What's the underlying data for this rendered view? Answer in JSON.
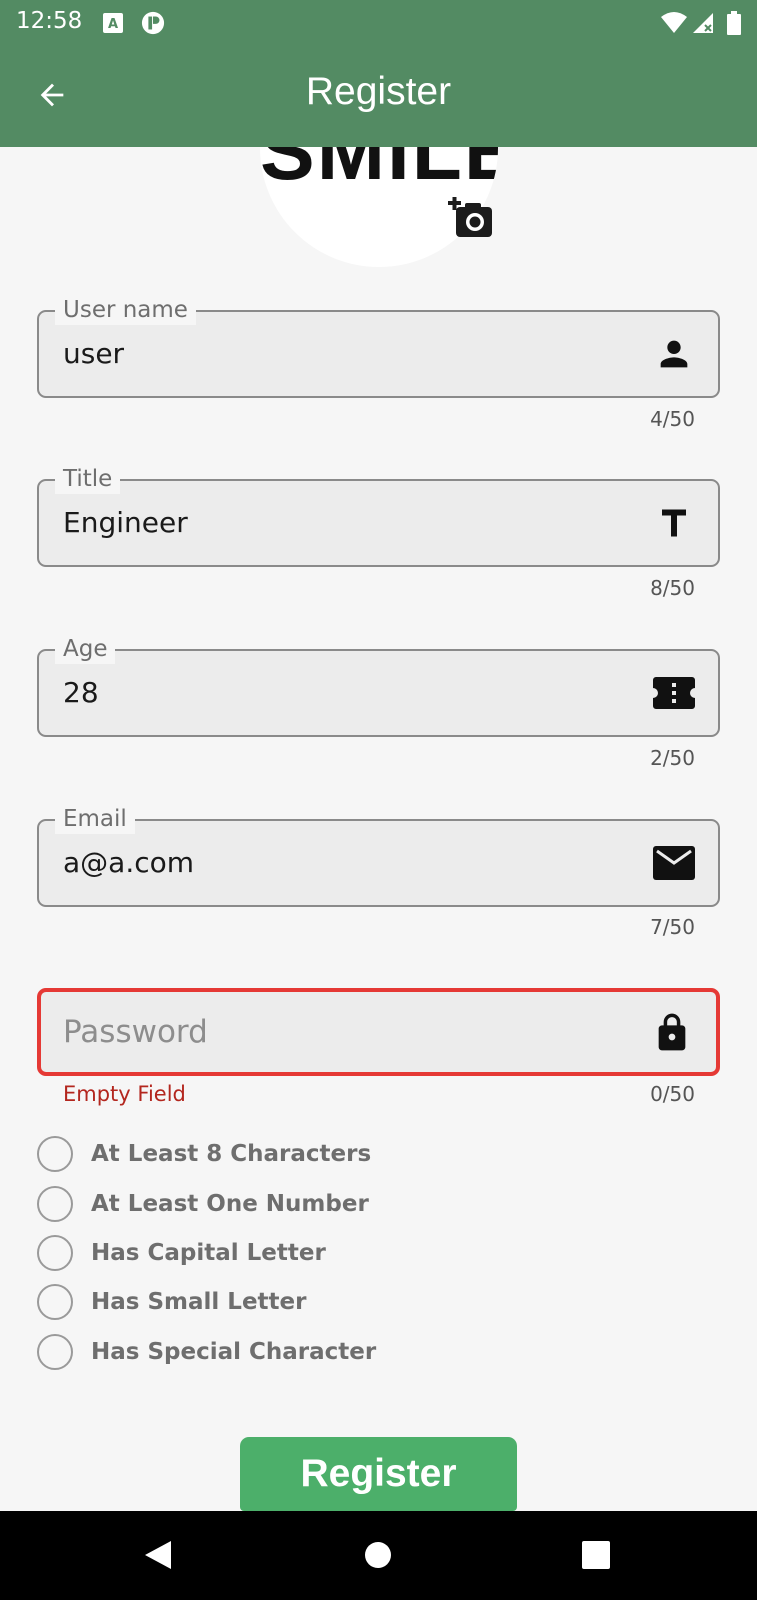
{
  "status_bar": {
    "time": "12:58",
    "icons": [
      "text-box-icon",
      "sync-badge-icon",
      "wifi-icon",
      "signal-icon",
      "battery-icon"
    ]
  },
  "app_bar": {
    "title": "Register",
    "back_icon": "arrow-left-icon"
  },
  "avatar": {
    "text": "SMILE",
    "add_photo_icon": "add-photo-camera-icon"
  },
  "fields": [
    {
      "label": "User name",
      "value": "user",
      "counter": "4/50",
      "icon": "person-icon"
    },
    {
      "label": "Title",
      "value": "Engineer",
      "counter": "8/50",
      "icon": "title-t-icon"
    },
    {
      "label": "Age",
      "value": "28",
      "counter": "2/50",
      "icon": "ticket-icon"
    },
    {
      "label": "Email",
      "value": "a@a.com",
      "counter": "7/50",
      "icon": "mail-icon"
    },
    {
      "placeholder": "Password",
      "value": "",
      "counter": "0/50",
      "error": "Empty Field",
      "icon": "lock-icon"
    }
  ],
  "requirements": [
    "At Least 8 Characters",
    "At Least One Number",
    "Has Capital Letter",
    "Has Small Letter",
    "Has Special Character"
  ],
  "register_button": "Register",
  "colors": {
    "app_bar": "#538b63",
    "button": "#4caf6a",
    "error": "#e53935",
    "background": "#f6f6f6"
  },
  "nav": {
    "back": "nav-back-icon",
    "home": "nav-home-icon",
    "recents": "nav-recents-icon"
  }
}
